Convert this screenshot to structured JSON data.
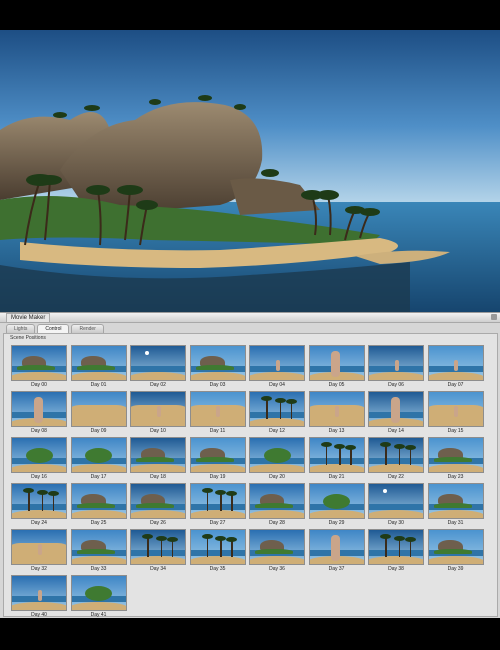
{
  "panel": {
    "title": "Movie Maker",
    "tabs": [
      {
        "label": "Lights",
        "active": false
      },
      {
        "label": "Control",
        "active": true
      },
      {
        "label": "Render",
        "active": false
      }
    ],
    "section_label": "Scene Positions"
  },
  "thumbnails": [
    {
      "label": "Day 00",
      "style": "rock-beach"
    },
    {
      "label": "Day 01",
      "style": "rock-beach"
    },
    {
      "label": "Day 02",
      "style": "sun-sky"
    },
    {
      "label": "Day 03",
      "style": "rock-beach"
    },
    {
      "label": "Day 04",
      "style": "figure-beach"
    },
    {
      "label": "Day 05",
      "style": "figure-close"
    },
    {
      "label": "Day 06",
      "style": "figure-beach"
    },
    {
      "label": "Day 07",
      "style": "figure-beach"
    },
    {
      "label": "Day 08",
      "style": "figure-close"
    },
    {
      "label": "Day 09",
      "style": "sand"
    },
    {
      "label": "Day 10",
      "style": "sand-figure"
    },
    {
      "label": "Day 11",
      "style": "sand-figure"
    },
    {
      "label": "Day 12",
      "style": "beach-palms"
    },
    {
      "label": "Day 13",
      "style": "sand-figure"
    },
    {
      "label": "Day 14",
      "style": "figure-close"
    },
    {
      "label": "Day 15",
      "style": "sand-figure"
    },
    {
      "label": "Day 16",
      "style": "island-aerial"
    },
    {
      "label": "Day 17",
      "style": "island-aerial"
    },
    {
      "label": "Day 18",
      "style": "rock-green"
    },
    {
      "label": "Day 19",
      "style": "rock-green"
    },
    {
      "label": "Day 20",
      "style": "island-aerial"
    },
    {
      "label": "Day 21",
      "style": "palm-frame"
    },
    {
      "label": "Day 22",
      "style": "palms"
    },
    {
      "label": "Day 23",
      "style": "rock-beach"
    },
    {
      "label": "Day 24",
      "style": "beach-palms"
    },
    {
      "label": "Day 25",
      "style": "rock-beach"
    },
    {
      "label": "Day 26",
      "style": "rock-beach"
    },
    {
      "label": "Day 27",
      "style": "palms"
    },
    {
      "label": "Day 28",
      "style": "rock-green"
    },
    {
      "label": "Day 29",
      "style": "island-aerial"
    },
    {
      "label": "Day 30",
      "style": "sun-sky"
    },
    {
      "label": "Day 31",
      "style": "rock-green"
    },
    {
      "label": "Day 32",
      "style": "sand-figure"
    },
    {
      "label": "Day 33",
      "style": "rock-beach"
    },
    {
      "label": "Day 34",
      "style": "beach-palms"
    },
    {
      "label": "Day 35",
      "style": "palms"
    },
    {
      "label": "Day 36",
      "style": "rock-beach"
    },
    {
      "label": "Day 37",
      "style": "figure-close"
    },
    {
      "label": "Day 38",
      "style": "beach-palms"
    },
    {
      "label": "Day 39",
      "style": "rock-beach"
    },
    {
      "label": "Day 40",
      "style": "figure-beach"
    },
    {
      "label": "Day 41",
      "style": "island-aerial"
    }
  ]
}
